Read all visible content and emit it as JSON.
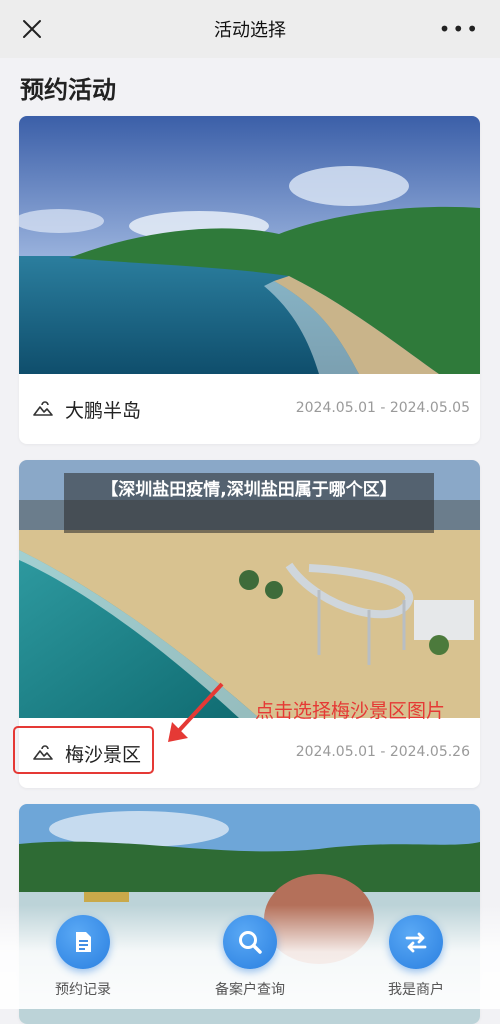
{
  "header": {
    "title": "活动选择",
    "close_icon": "close-icon",
    "more_icon": "more-icon",
    "more_glyph": "•••"
  },
  "section": {
    "title": "预约活动"
  },
  "activities": [
    {
      "name": "大鹏半岛",
      "date_range": "2024.05.01 - 2024.05.05",
      "icon": "weather-mountain-icon"
    },
    {
      "name": "梅沙景区",
      "date_range": "2024.05.01 - 2024.05.26",
      "icon": "weather-mountain-icon"
    }
  ],
  "overlay": {
    "title": "【深圳盐田疫情,深圳盐田属于哪个区】"
  },
  "annotation": {
    "text": "点击选择梅沙景区图片",
    "color": "#e53935"
  },
  "bottom_nav": [
    {
      "label": "预约记录",
      "icon": "document-icon"
    },
    {
      "label": "备案户查询",
      "icon": "search-icon"
    },
    {
      "label": "我是商户",
      "icon": "switch-icon"
    }
  ],
  "colors": {
    "accent": "#2a7fe0",
    "background": "#f2f2f5",
    "date_text": "#9a9a9a"
  }
}
